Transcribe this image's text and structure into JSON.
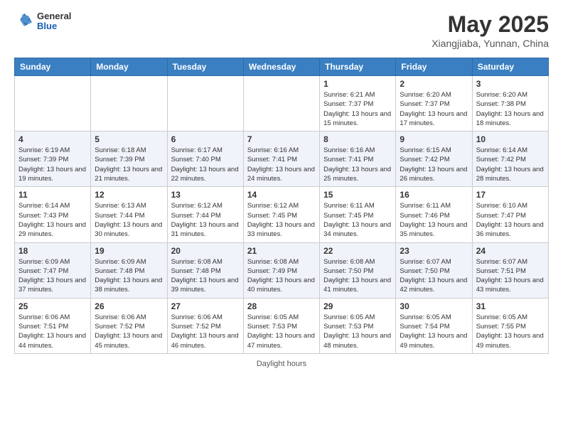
{
  "header": {
    "logo_general": "General",
    "logo_blue": "Blue",
    "month_year": "May 2025",
    "location": "Xiangjiaba, Yunnan, China"
  },
  "days_of_week": [
    "Sunday",
    "Monday",
    "Tuesday",
    "Wednesday",
    "Thursday",
    "Friday",
    "Saturday"
  ],
  "footer": {
    "label": "Daylight hours"
  },
  "weeks": [
    [
      {
        "day": "",
        "info": ""
      },
      {
        "day": "",
        "info": ""
      },
      {
        "day": "",
        "info": ""
      },
      {
        "day": "",
        "info": ""
      },
      {
        "day": "1",
        "info": "Sunrise: 6:21 AM\nSunset: 7:37 PM\nDaylight: 13 hours and 15 minutes."
      },
      {
        "day": "2",
        "info": "Sunrise: 6:20 AM\nSunset: 7:37 PM\nDaylight: 13 hours and 17 minutes."
      },
      {
        "day": "3",
        "info": "Sunrise: 6:20 AM\nSunset: 7:38 PM\nDaylight: 13 hours and 18 minutes."
      }
    ],
    [
      {
        "day": "4",
        "info": "Sunrise: 6:19 AM\nSunset: 7:39 PM\nDaylight: 13 hours and 19 minutes."
      },
      {
        "day": "5",
        "info": "Sunrise: 6:18 AM\nSunset: 7:39 PM\nDaylight: 13 hours and 21 minutes."
      },
      {
        "day": "6",
        "info": "Sunrise: 6:17 AM\nSunset: 7:40 PM\nDaylight: 13 hours and 22 minutes."
      },
      {
        "day": "7",
        "info": "Sunrise: 6:16 AM\nSunset: 7:41 PM\nDaylight: 13 hours and 24 minutes."
      },
      {
        "day": "8",
        "info": "Sunrise: 6:16 AM\nSunset: 7:41 PM\nDaylight: 13 hours and 25 minutes."
      },
      {
        "day": "9",
        "info": "Sunrise: 6:15 AM\nSunset: 7:42 PM\nDaylight: 13 hours and 26 minutes."
      },
      {
        "day": "10",
        "info": "Sunrise: 6:14 AM\nSunset: 7:42 PM\nDaylight: 13 hours and 28 minutes."
      }
    ],
    [
      {
        "day": "11",
        "info": "Sunrise: 6:14 AM\nSunset: 7:43 PM\nDaylight: 13 hours and 29 minutes."
      },
      {
        "day": "12",
        "info": "Sunrise: 6:13 AM\nSunset: 7:44 PM\nDaylight: 13 hours and 30 minutes."
      },
      {
        "day": "13",
        "info": "Sunrise: 6:12 AM\nSunset: 7:44 PM\nDaylight: 13 hours and 31 minutes."
      },
      {
        "day": "14",
        "info": "Sunrise: 6:12 AM\nSunset: 7:45 PM\nDaylight: 13 hours and 33 minutes."
      },
      {
        "day": "15",
        "info": "Sunrise: 6:11 AM\nSunset: 7:45 PM\nDaylight: 13 hours and 34 minutes."
      },
      {
        "day": "16",
        "info": "Sunrise: 6:11 AM\nSunset: 7:46 PM\nDaylight: 13 hours and 35 minutes."
      },
      {
        "day": "17",
        "info": "Sunrise: 6:10 AM\nSunset: 7:47 PM\nDaylight: 13 hours and 36 minutes."
      }
    ],
    [
      {
        "day": "18",
        "info": "Sunrise: 6:09 AM\nSunset: 7:47 PM\nDaylight: 13 hours and 37 minutes."
      },
      {
        "day": "19",
        "info": "Sunrise: 6:09 AM\nSunset: 7:48 PM\nDaylight: 13 hours and 38 minutes."
      },
      {
        "day": "20",
        "info": "Sunrise: 6:08 AM\nSunset: 7:48 PM\nDaylight: 13 hours and 39 minutes."
      },
      {
        "day": "21",
        "info": "Sunrise: 6:08 AM\nSunset: 7:49 PM\nDaylight: 13 hours and 40 minutes."
      },
      {
        "day": "22",
        "info": "Sunrise: 6:08 AM\nSunset: 7:50 PM\nDaylight: 13 hours and 41 minutes."
      },
      {
        "day": "23",
        "info": "Sunrise: 6:07 AM\nSunset: 7:50 PM\nDaylight: 13 hours and 42 minutes."
      },
      {
        "day": "24",
        "info": "Sunrise: 6:07 AM\nSunset: 7:51 PM\nDaylight: 13 hours and 43 minutes."
      }
    ],
    [
      {
        "day": "25",
        "info": "Sunrise: 6:06 AM\nSunset: 7:51 PM\nDaylight: 13 hours and 44 minutes."
      },
      {
        "day": "26",
        "info": "Sunrise: 6:06 AM\nSunset: 7:52 PM\nDaylight: 13 hours and 45 minutes."
      },
      {
        "day": "27",
        "info": "Sunrise: 6:06 AM\nSunset: 7:52 PM\nDaylight: 13 hours and 46 minutes."
      },
      {
        "day": "28",
        "info": "Sunrise: 6:05 AM\nSunset: 7:53 PM\nDaylight: 13 hours and 47 minutes."
      },
      {
        "day": "29",
        "info": "Sunrise: 6:05 AM\nSunset: 7:53 PM\nDaylight: 13 hours and 48 minutes."
      },
      {
        "day": "30",
        "info": "Sunrise: 6:05 AM\nSunset: 7:54 PM\nDaylight: 13 hours and 49 minutes."
      },
      {
        "day": "31",
        "info": "Sunrise: 6:05 AM\nSunset: 7:55 PM\nDaylight: 13 hours and 49 minutes."
      }
    ]
  ]
}
